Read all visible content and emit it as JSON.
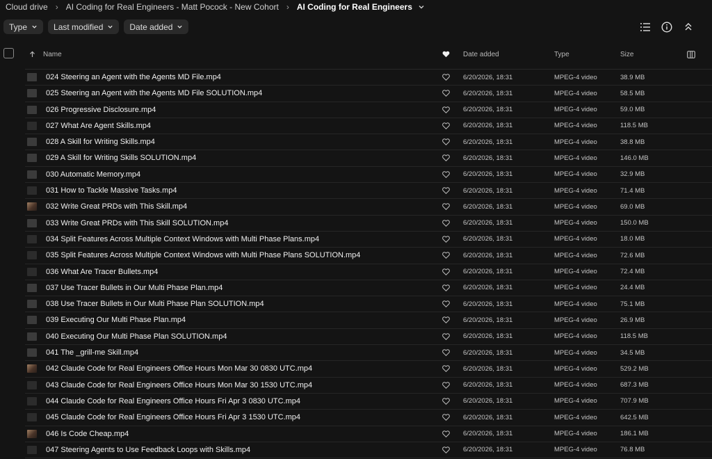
{
  "breadcrumb": {
    "root": "Cloud drive",
    "parent": "AI Coding for Real Engineers - Matt Pocock - New Cohort",
    "current": "AI Coding for Real Engineers"
  },
  "filters": [
    "Type",
    "Last modified",
    "Date added"
  ],
  "columns": {
    "name": "Name",
    "date_added": "Date added",
    "type": "Type",
    "size": "Size"
  },
  "files": [
    {
      "name": "024 Steering an Agent with the Agents MD File.mp4",
      "date": "6/20/2026, 18:31",
      "type": "MPEG-4 video",
      "size": "38.9 MB",
      "thumb": "screen"
    },
    {
      "name": "025 Steering an Agent with the Agents MD File SOLUTION.mp4",
      "date": "6/20/2026, 18:31",
      "type": "MPEG-4 video",
      "size": "58.5 MB",
      "thumb": "screen"
    },
    {
      "name": "026 Progressive Disclosure.mp4",
      "date": "6/20/2026, 18:31",
      "type": "MPEG-4 video",
      "size": "59.0 MB",
      "thumb": "screen"
    },
    {
      "name": "027 What Are Agent Skills.mp4",
      "date": "6/20/2026, 18:31",
      "type": "MPEG-4 video",
      "size": "118.5 MB",
      "thumb": "dark"
    },
    {
      "name": "028 A Skill for Writing Skills.mp4",
      "date": "6/20/2026, 18:31",
      "type": "MPEG-4 video",
      "size": "38.8 MB",
      "thumb": "screen"
    },
    {
      "name": "029 A Skill for Writing Skills SOLUTION.mp4",
      "date": "6/20/2026, 18:31",
      "type": "MPEG-4 video",
      "size": "146.0 MB",
      "thumb": "screen"
    },
    {
      "name": "030 Automatic Memory.mp4",
      "date": "6/20/2026, 18:31",
      "type": "MPEG-4 video",
      "size": "32.9 MB",
      "thumb": "screen"
    },
    {
      "name": "031 How to Tackle Massive Tasks.mp4",
      "date": "6/20/2026, 18:31",
      "type": "MPEG-4 video",
      "size": "71.4 MB",
      "thumb": "dark"
    },
    {
      "name": "032 Write Great PRDs with This Skill.mp4",
      "date": "6/20/2026, 18:31",
      "type": "MPEG-4 video",
      "size": "69.0 MB",
      "thumb": "person"
    },
    {
      "name": "033 Write Great PRDs with This Skill SOLUTION.mp4",
      "date": "6/20/2026, 18:31",
      "type": "MPEG-4 video",
      "size": "150.0 MB",
      "thumb": "screen"
    },
    {
      "name": "034 Split Features Across Multiple Context Windows with Multi Phase Plans.mp4",
      "date": "6/20/2026, 18:31",
      "type": "MPEG-4 video",
      "size": "18.0 MB",
      "thumb": "dark"
    },
    {
      "name": "035 Split Features Across Multiple Context Windows with Multi Phase Plans SOLUTION.mp4",
      "date": "6/20/2026, 18:31",
      "type": "MPEG-4 video",
      "size": "72.6 MB",
      "thumb": "dark"
    },
    {
      "name": "036 What Are Tracer Bullets.mp4",
      "date": "6/20/2026, 18:31",
      "type": "MPEG-4 video",
      "size": "72.4 MB",
      "thumb": "dark"
    },
    {
      "name": "037 Use Tracer Bullets in Our Multi Phase Plan.mp4",
      "date": "6/20/2026, 18:31",
      "type": "MPEG-4 video",
      "size": "24.4 MB",
      "thumb": "screen"
    },
    {
      "name": "038 Use Tracer Bullets in Our Multi Phase Plan SOLUTION.mp4",
      "date": "6/20/2026, 18:31",
      "type": "MPEG-4 video",
      "size": "75.1 MB",
      "thumb": "screen"
    },
    {
      "name": "039 Executing Our Multi Phase Plan.mp4",
      "date": "6/20/2026, 18:31",
      "type": "MPEG-4 video",
      "size": "26.9 MB",
      "thumb": "screen"
    },
    {
      "name": "040 Executing Our Multi Phase Plan SOLUTION.mp4",
      "date": "6/20/2026, 18:31",
      "type": "MPEG-4 video",
      "size": "118.5 MB",
      "thumb": "screen"
    },
    {
      "name": "041 The _grill-me Skill.mp4",
      "date": "6/20/2026, 18:31",
      "type": "MPEG-4 video",
      "size": "34.5 MB",
      "thumb": "screen"
    },
    {
      "name": "042 Claude Code for Real Engineers Office Hours Mon Mar 30 0830 UTC.mp4",
      "date": "6/20/2026, 18:31",
      "type": "MPEG-4 video",
      "size": "529.2 MB",
      "thumb": "person"
    },
    {
      "name": "043 Claude Code for Real Engineers Office Hours Mon Mar 30 1530 UTC.mp4",
      "date": "6/20/2026, 18:31",
      "type": "MPEG-4 video",
      "size": "687.3 MB",
      "thumb": "dark"
    },
    {
      "name": "044 Claude Code for Real Engineers Office Hours Fri Apr 3 0830 UTC.mp4",
      "date": "6/20/2026, 18:31",
      "type": "MPEG-4 video",
      "size": "707.9 MB",
      "thumb": "dark"
    },
    {
      "name": "045 Claude Code for Real Engineers Office Hours Fri Apr 3 1530 UTC.mp4",
      "date": "6/20/2026, 18:31",
      "type": "MPEG-4 video",
      "size": "642.5 MB",
      "thumb": "dark"
    },
    {
      "name": "046 Is Code Cheap.mp4",
      "date": "6/20/2026, 18:31",
      "type": "MPEG-4 video",
      "size": "186.1 MB",
      "thumb": "person"
    },
    {
      "name": "047 Steering Agents to Use Feedback Loops with Skills.mp4",
      "date": "6/20/2026, 18:31",
      "type": "MPEG-4 video",
      "size": "76.8 MB",
      "thumb": "dark"
    }
  ]
}
